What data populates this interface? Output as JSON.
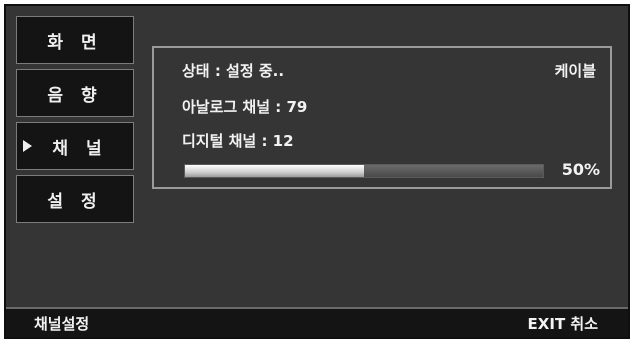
{
  "menu": {
    "items": [
      {
        "label": "화 면",
        "active": false
      },
      {
        "label": "음 향",
        "active": false
      },
      {
        "label": "채 널",
        "active": true
      },
      {
        "label": "설 정",
        "active": false
      }
    ]
  },
  "status": {
    "state": "상태 : 설정 중..",
    "source": "케이블",
    "analog": "아날로그 채널 : 79",
    "digital": "디지털 채널 : 12"
  },
  "progress": {
    "value": 0.5,
    "label": "50%"
  },
  "footer": {
    "title": "채널설정",
    "exit_label": "EXIT 취소"
  },
  "colors": {
    "background": "#353535",
    "menu_bg": "#141414",
    "text": "#f2f2f2"
  }
}
